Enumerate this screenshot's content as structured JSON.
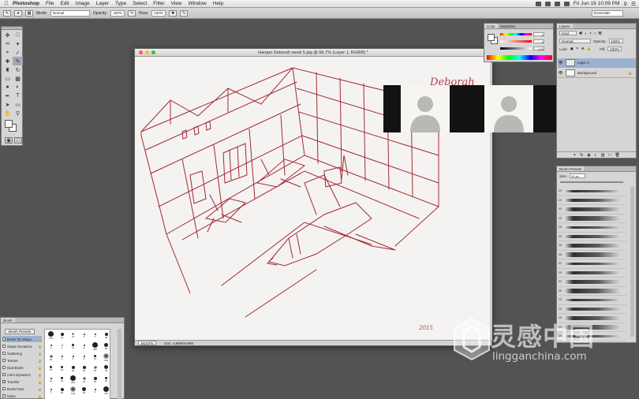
{
  "menubar": {
    "app": "Photoshop",
    "menus": [
      "File",
      "Edit",
      "Image",
      "Layer",
      "Type",
      "Select",
      "Filter",
      "View",
      "Window",
      "Help"
    ],
    "datetime": "Fri Jun 19  10:09 PM"
  },
  "options": {
    "mode_label": "Mode:",
    "mode_value": "Normal",
    "opacity_label": "Opacity:",
    "opacity_value": "100%",
    "flow_label": "Flow:",
    "flow_value": "100%",
    "workspace": "Essentials"
  },
  "document": {
    "title": "Hangar Deborah week 5.jpg @ 66.7% (Layer 1, RGB/8) *",
    "zoom": "66.67%",
    "doc_info": "Doc: 4.85M/9.86M",
    "canvas_text": "Deborah",
    "signature": "2015"
  },
  "color_panel": {
    "tabs": [
      "Color",
      "Swatches"
    ],
    "values": [
      "0",
      "0",
      "100"
    ]
  },
  "layers_panel": {
    "tabs": [
      "Layers"
    ],
    "kind_label": "Kind",
    "blend_mode": "Normal",
    "opacity_label": "Opacity:",
    "opacity_value": "100%",
    "lock_label": "Lock:",
    "fill_label": "Fill:",
    "fill_value": "100%",
    "layers": [
      {
        "name": "Layer 1",
        "selected": true
      },
      {
        "name": "Background",
        "selected": false
      }
    ]
  },
  "brush_presets_panel": {
    "tabs": [
      "Brush Presets"
    ],
    "size_label": "Size:",
    "size_value": "10 px",
    "stroke_numbers": [
      "25",
      "25",
      "30",
      "25",
      "25",
      "25",
      "36",
      "36",
      "32",
      "25",
      "50",
      "25",
      "25",
      "25",
      "25",
      "25",
      "25"
    ]
  },
  "brush_panel": {
    "tabs": [
      "Brush"
    ],
    "presets_button": "Brush Presets",
    "options": [
      {
        "label": "Brush Tip Shape",
        "checked": false,
        "selected": true
      },
      {
        "label": "Shape Dynamics",
        "checked": false,
        "selected": false
      },
      {
        "label": "Scattering",
        "checked": false,
        "selected": false
      },
      {
        "label": "Texture",
        "checked": false,
        "selected": false
      },
      {
        "label": "Dual Brush",
        "checked": false,
        "selected": false
      },
      {
        "label": "Color Dynamics",
        "checked": false,
        "selected": false
      },
      {
        "label": "Transfer",
        "checked": true,
        "selected": false
      },
      {
        "label": "Brush Pose",
        "checked": false,
        "selected": false
      },
      {
        "label": "Noise",
        "checked": false,
        "selected": false
      }
    ],
    "tip_sizes": [
      "150",
      "32",
      "13",
      "5",
      "7",
      "28",
      "4",
      "4",
      "14",
      "6",
      "300",
      "60",
      "30",
      "1",
      "5",
      "6",
      "13",
      "100",
      "20",
      "20",
      "25",
      "40",
      "25",
      "45",
      "10",
      "13",
      "250",
      "40",
      "30",
      "20",
      "5",
      "40",
      "126",
      "60",
      "9",
      "115"
    ]
  },
  "watermark": {
    "text": "灵感中国",
    "url": "lingganchina.com"
  }
}
